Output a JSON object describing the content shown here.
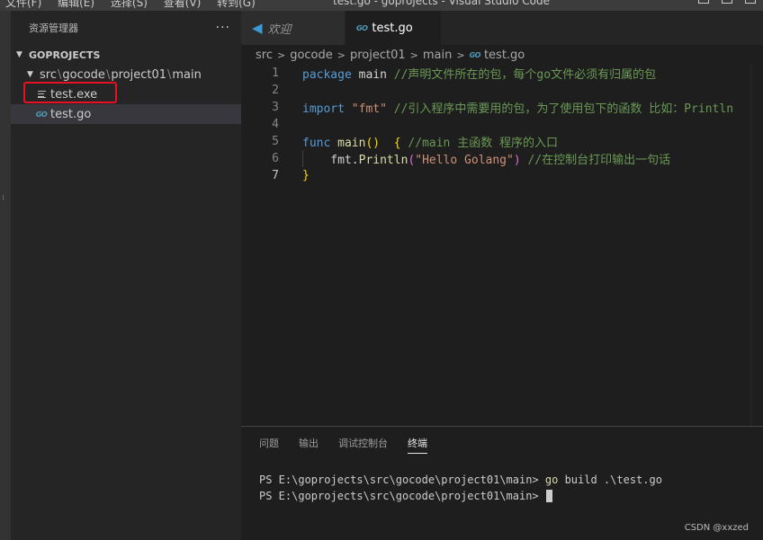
{
  "titlebar": {
    "menu": [
      "文件(F)",
      "编辑(E)",
      "选择(S)",
      "查看(V)",
      "转到(G)"
    ],
    "title": "test.go - goprojects - Visual Studio Code"
  },
  "sidebar": {
    "header": "资源管理器",
    "more": "···",
    "section": "GOPROJECTS",
    "folder": [
      "src",
      "gocode",
      "project01",
      "main"
    ],
    "files": [
      {
        "name": "test.exe",
        "icon": "file-lines-icon"
      },
      {
        "name": "test.go",
        "icon": "go-file-icon"
      }
    ]
  },
  "editor": {
    "tabs": [
      {
        "label": "欢迎",
        "icon": "vscode-icon"
      },
      {
        "label": "test.go",
        "icon": "go-file-icon",
        "close": "×"
      }
    ],
    "breadcrumb": [
      "src",
      "gocode",
      "project01",
      "main",
      "test.go"
    ],
    "go_icon_text": "GO",
    "vs_icon_text": "◀",
    "lines": [
      {
        "n": "1",
        "tokens": [
          [
            "kw",
            "package"
          ],
          [
            "pl",
            " main "
          ],
          [
            "cm",
            "//声明文件所在的包，每个go文件必须有归属的包"
          ]
        ]
      },
      {
        "n": "2",
        "tokens": []
      },
      {
        "n": "3",
        "tokens": [
          [
            "kw",
            "import"
          ],
          [
            "pl",
            " "
          ],
          [
            "str",
            "\"fmt\""
          ],
          [
            "pl",
            " "
          ],
          [
            "cm",
            "//引入程序中需要用的包，为了使用包下的函数 比如：Println"
          ]
        ]
      },
      {
        "n": "4",
        "tokens": []
      },
      {
        "n": "5",
        "tokens": [
          [
            "kw",
            "func"
          ],
          [
            "pl",
            " "
          ],
          [
            "fn",
            "main"
          ],
          [
            "br1",
            "()"
          ],
          [
            "pl",
            "  "
          ],
          [
            "br1",
            "{"
          ],
          [
            "pl",
            " "
          ],
          [
            "cm",
            "//main 主函数 程序的入口"
          ]
        ]
      },
      {
        "n": "6",
        "tokens": [
          [
            "pl",
            "    fmt."
          ],
          [
            "fn",
            "Println"
          ],
          [
            "br2",
            "("
          ],
          [
            "str",
            "\"Hello Golang\""
          ],
          [
            "br2",
            ")"
          ],
          [
            "pl",
            " "
          ],
          [
            "cm",
            "//在控制台打印输出一句话"
          ]
        ]
      },
      {
        "n": "7",
        "tokens": [
          [
            "br1",
            "}"
          ]
        ]
      }
    ],
    "current_line": "7"
  },
  "panel": {
    "tabs": [
      "问题",
      "输出",
      "调试控制台",
      "终端"
    ],
    "active_tab": "终端",
    "terminal": [
      {
        "prompt": "PS E:\\goprojects\\src\\gocode\\project01\\main> ",
        "cmd": "go",
        "args": " build .\\test.go"
      },
      {
        "prompt": "PS E:\\goprojects\\src\\gocode\\project01\\main> ",
        "cmd": "",
        "args": ""
      }
    ]
  },
  "watermark": "CSDN @xxzed",
  "colors": {
    "highlight_box": "#e81123",
    "keyword": "#569cd6",
    "function": "#dcdcaa",
    "string": "#ce9178",
    "comment": "#6a9955"
  }
}
